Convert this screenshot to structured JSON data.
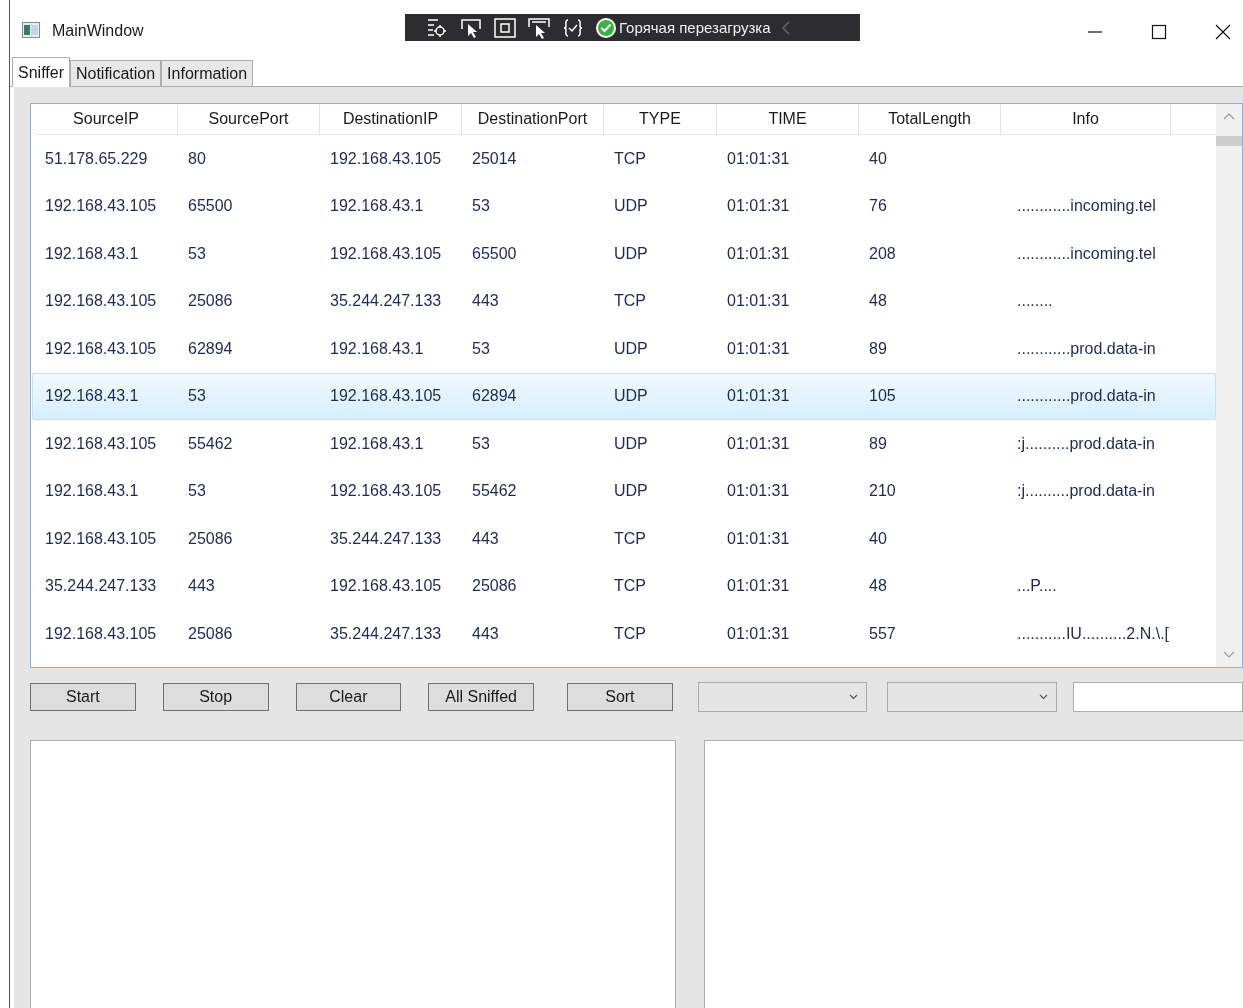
{
  "window": {
    "title": "MainWindow"
  },
  "debug_toolbar": {
    "status": "Горячая перезагрузка"
  },
  "tabs": [
    {
      "label": "Sniffer",
      "selected": true
    },
    {
      "label": "Notification",
      "selected": false
    },
    {
      "label": "Information",
      "selected": false
    }
  ],
  "table": {
    "columns": [
      "SourceIP",
      "SourcePort",
      "DestinationIP",
      "DestinationPort",
      "TYPE",
      "TIME",
      "TotalLength",
      "Info"
    ],
    "rows": [
      {
        "cells": [
          "51.178.65.229",
          "80",
          "192.168.43.105",
          "25014",
          "TCP",
          "01:01:31",
          "40",
          ""
        ],
        "selected": false
      },
      {
        "cells": [
          "192.168.43.105",
          "65500",
          "192.168.43.1",
          "53",
          "UDP",
          "01:01:31",
          "76",
          "............incoming.tel"
        ],
        "selected": false
      },
      {
        "cells": [
          "192.168.43.1",
          "53",
          "192.168.43.105",
          "65500",
          "UDP",
          "01:01:31",
          "208",
          "............incoming.tel"
        ],
        "selected": false
      },
      {
        "cells": [
          "192.168.43.105",
          "25086",
          "35.244.247.133",
          "443",
          "TCP",
          "01:01:31",
          "48",
          "........"
        ],
        "selected": false
      },
      {
        "cells": [
          "192.168.43.105",
          "62894",
          "192.168.43.1",
          "53",
          "UDP",
          "01:01:31",
          "89",
          "............prod.data-in"
        ],
        "selected": false
      },
      {
        "cells": [
          "192.168.43.1",
          "53",
          "192.168.43.105",
          "62894",
          "UDP",
          "01:01:31",
          "105",
          "............prod.data-in"
        ],
        "selected": true
      },
      {
        "cells": [
          "192.168.43.105",
          "55462",
          "192.168.43.1",
          "53",
          "UDP",
          "01:01:31",
          "89",
          ":j..........prod.data-in"
        ],
        "selected": false
      },
      {
        "cells": [
          "192.168.43.1",
          "53",
          "192.168.43.105",
          "55462",
          "UDP",
          "01:01:31",
          "210",
          ":j..........prod.data-in"
        ],
        "selected": false
      },
      {
        "cells": [
          "192.168.43.105",
          "25086",
          "35.244.247.133",
          "443",
          "TCP",
          "01:01:31",
          "40",
          ""
        ],
        "selected": false
      },
      {
        "cells": [
          "35.244.247.133",
          "443",
          "192.168.43.105",
          "25086",
          "TCP",
          "01:01:31",
          "48",
          "...P...."
        ],
        "selected": false
      },
      {
        "cells": [
          "192.168.43.105",
          "25086",
          "35.244.247.133",
          "443",
          "TCP",
          "01:01:31",
          "557",
          "...........IU..........2.N.\\.["
        ],
        "selected": false
      }
    ]
  },
  "buttons": [
    "Start",
    "Stop",
    "Clear",
    "All Sniffed",
    "Sort"
  ]
}
